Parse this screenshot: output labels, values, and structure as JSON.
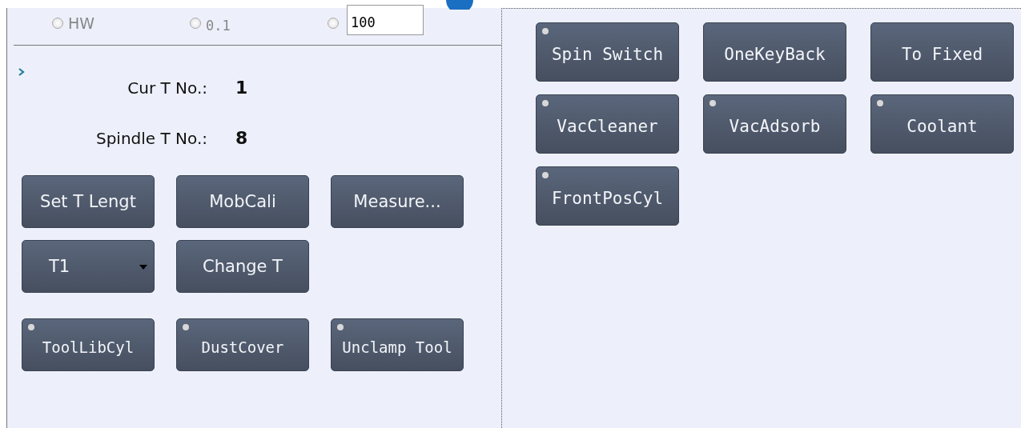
{
  "step_options": [
    {
      "label": "HW",
      "selected": false
    },
    {
      "label": "0.1",
      "selected": false
    },
    {
      "selected": false
    }
  ],
  "custom_step": {
    "value": "100"
  },
  "tool_info": {
    "rows": [
      {
        "label": "Cur T No.:",
        "value": "1"
      },
      {
        "label": "Spindle T No.:",
        "value": "8"
      }
    ]
  },
  "left_buttons": [
    {
      "kind": "action",
      "label": "Set T Lengt"
    },
    {
      "kind": "action",
      "label": "MobCali"
    },
    {
      "kind": "action",
      "label": "Measure..."
    },
    {
      "kind": "dropdown",
      "label": "T1"
    },
    {
      "kind": "action",
      "label": "Change T"
    },
    {
      "kind": "toggle",
      "label": "ToolLibCyl",
      "on": false
    },
    {
      "kind": "toggle",
      "label": "DustCover",
      "on": false
    },
    {
      "kind": "toggle",
      "label": "Unclamp Tool",
      "on": false
    }
  ],
  "right_buttons": [
    {
      "kind": "toggle",
      "label": "Spin Switch",
      "on": false
    },
    {
      "kind": "action",
      "label": "OneKeyBack"
    },
    {
      "kind": "action",
      "label": "To Fixed"
    },
    {
      "kind": "toggle",
      "label": "VacCleaner",
      "on": false
    },
    {
      "kind": "toggle",
      "label": "VacAdsorb",
      "on": false
    },
    {
      "kind": "toggle",
      "label": "Coolant",
      "on": false
    },
    {
      "kind": "toggle",
      "label": "FrontPosCyl",
      "on": false
    }
  ]
}
